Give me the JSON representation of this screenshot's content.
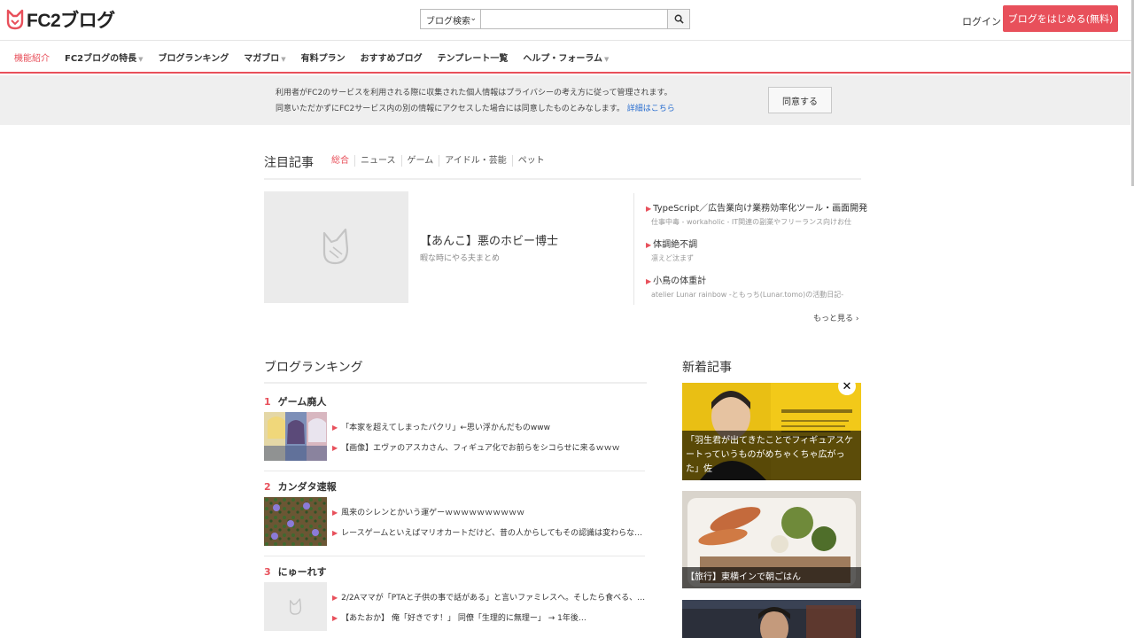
{
  "header": {
    "logo_text": "FC2ブログ",
    "search_select": "ブログ検索",
    "search_placeholder": "",
    "login": "ログイン",
    "start_button": "ブログをはじめる(無料)"
  },
  "nav": {
    "items": [
      {
        "label": "機能紹介",
        "active": true
      },
      {
        "label": "FC2ブログの特長",
        "dropdown": true
      },
      {
        "label": "ブログランキング"
      },
      {
        "label": "マガブロ",
        "dropdown": true
      },
      {
        "label": "有料プラン"
      },
      {
        "label": "おすすめブログ"
      },
      {
        "label": "テンプレート一覧"
      },
      {
        "label": "ヘルプ・フォーラム",
        "dropdown": true
      }
    ],
    "dropdown_glyph": "▼"
  },
  "consent": {
    "line1": "利用者がFC2のサービスを利用される際に収集された個人情報はプライバシーの考え方に従って管理されます。",
    "line2": "同意いただかずにFC2サービス内の別の情報にアクセスした場合には同意したものとみなします。",
    "link": "詳細はこちら",
    "agree_button": "同意する"
  },
  "featured": {
    "title": "注目記事",
    "tabs": [
      "総合",
      "ニュース",
      "ゲーム",
      "アイドル・芸能",
      "ペット"
    ],
    "main_title": "【あんこ】悪のホビー博士",
    "main_sub": "暇な時にやる夫まとめ",
    "side": [
      {
        "title": "TypeScript／広告業向け業務効率化ツール・画面開発",
        "sub": "仕事中毒 - workaholic - IT関連の副業やフリーランス向けお仕"
      },
      {
        "title": "体調絶不調",
        "sub": "凛えど汰まず"
      },
      {
        "title": "小鳥の体重計",
        "sub": "atelier Lunar rainbow -ともっち(Lunar.tomo)の活動日記-"
      }
    ],
    "more": "もっと見る ›"
  },
  "ranking": {
    "title": "ブログランキング",
    "entries": [
      {
        "rank": "1",
        "name": "ゲーム廃人",
        "items": [
          "「本家を超えてしまったパクリ」←思い浮かんだものwww",
          "【画像】エヴァのアスカさん、フィギュア化でお前らをシコらせに来るｗｗｗ"
        ]
      },
      {
        "rank": "2",
        "name": "カンダタ速報",
        "items": [
          "風来のシレンとかいう運ゲーｗｗｗｗｗｗｗｗｗｗ",
          "レースゲームといえばマリオカートだけど、昔の人からしてもその認識は変わらない…"
        ]
      },
      {
        "rank": "3",
        "name": "にゅーれす",
        "items": [
          "2/2Aママが「PTAと子供の事で話がある」と言いファミレスへ。そしたら食べる、…",
          "【あたおか】 俺「好きです！」 同僚「生理的に無理ー」 → 1年後…"
        ]
      }
    ]
  },
  "new_posts": {
    "title": "新着記事",
    "close": "✕",
    "items": [
      {
        "caption": "「羽生君が出てきたことでフィギュアスケートっていうものがめちゃくちゃ広がった」佐"
      },
      {
        "caption": "【旅行】東横インで朝ごはん"
      },
      {
        "caption": ""
      }
    ]
  },
  "colors": {
    "accent": "#e8505b",
    "link": "#2b6fd0"
  }
}
